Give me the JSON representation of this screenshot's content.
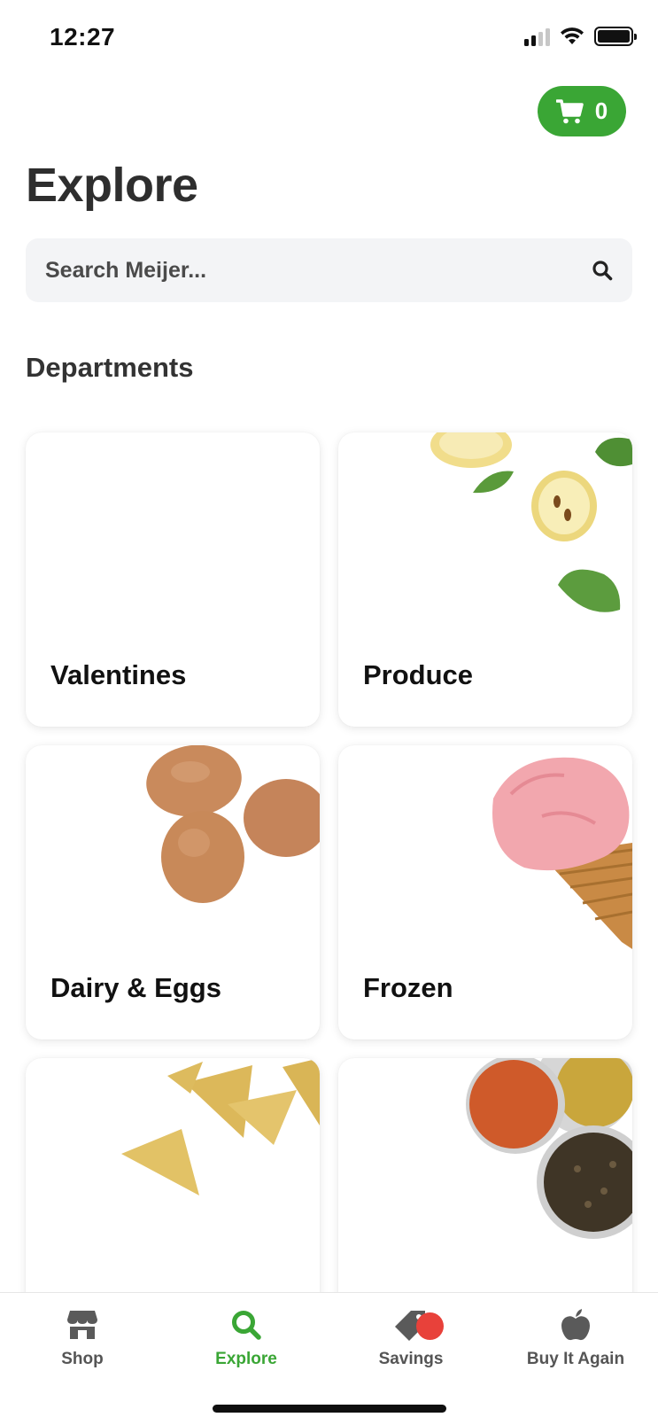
{
  "status_bar": {
    "time": "12:27"
  },
  "header": {
    "cart_count": "0",
    "title": "Explore"
  },
  "search": {
    "placeholder": "Search Meijer..."
  },
  "departments": {
    "heading": "Departments",
    "items": [
      {
        "label": "Valentines"
      },
      {
        "label": "Produce"
      },
      {
        "label": "Dairy & Eggs"
      },
      {
        "label": "Frozen"
      },
      {
        "label": ""
      },
      {
        "label": ""
      }
    ]
  },
  "nav": {
    "items": [
      {
        "label": "Shop",
        "icon": "store-icon"
      },
      {
        "label": "Explore",
        "icon": "search-icon"
      },
      {
        "label": "Savings",
        "icon": "tag-icon"
      },
      {
        "label": "Buy It Again",
        "icon": "apple-icon"
      }
    ]
  },
  "colors": {
    "brand_green": "#3aa635",
    "badge_red": "#e8413a"
  }
}
